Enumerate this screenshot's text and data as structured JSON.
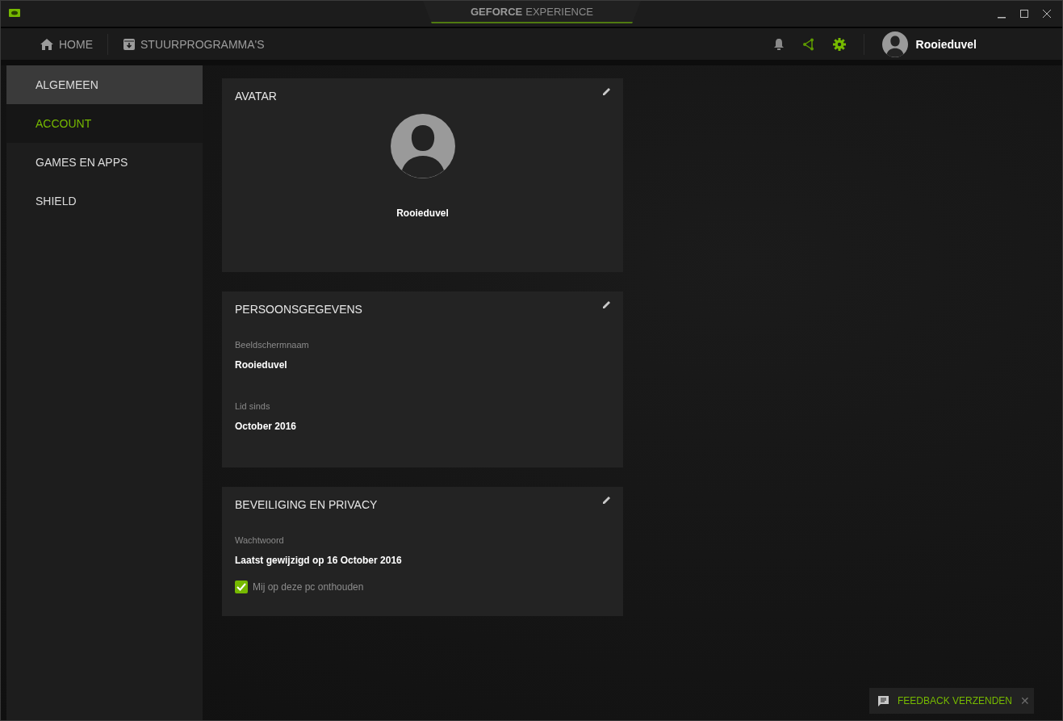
{
  "window": {
    "title_brand": "GEFORCE",
    "title_product": "EXPERIENCE"
  },
  "nav": {
    "tabs": [
      {
        "label": "HOME",
        "selected": false
      },
      {
        "label": "STUURPROGRAMMA'S",
        "selected": false
      }
    ],
    "user": "Rooieduvel"
  },
  "sidebar": {
    "items": [
      {
        "label": "ALGEMEEN",
        "selected": false,
        "hovered": true
      },
      {
        "label": "ACCOUNT",
        "selected": true,
        "hovered": false
      },
      {
        "label": "GAMES EN APPS",
        "selected": false,
        "hovered": false
      },
      {
        "label": "SHIELD",
        "selected": false,
        "hovered": false
      }
    ]
  },
  "cards": [
    {
      "kind": "avatar",
      "title": "AVATAR",
      "name": "Rooieduvel"
    },
    {
      "kind": "details",
      "title": "PERSOONSGEGEVENS",
      "fields": [
        {
          "label": "Beeldschermnaam",
          "value": "Rooieduvel"
        },
        {
          "label": "Lid sinds",
          "value": "October 2016"
        }
      ]
    },
    {
      "kind": "details",
      "title": "BEVEILIGING EN PRIVACY",
      "fields": [
        {
          "label": "Wachtwoord",
          "value": "Laatst gewijzigd op 16 October 2016"
        }
      ],
      "checkbox": {
        "label": "Mij op deze pc onthouden",
        "checked": true
      }
    }
  ],
  "feedback": {
    "label": "FEEDBACK VERZENDEN",
    "close": "✕"
  }
}
